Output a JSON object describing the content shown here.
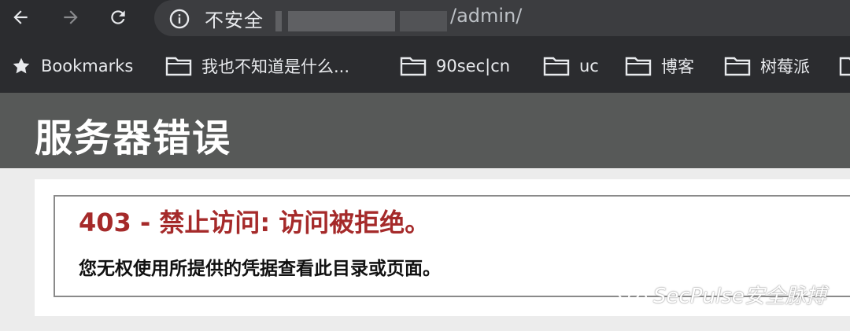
{
  "browser": {
    "address": {
      "security_label": "不安全",
      "path": "/admin/"
    },
    "bookmarks": [
      {
        "label": "Bookmarks",
        "icon": "star-icon"
      },
      {
        "label": "我也不知道是什么...",
        "icon": "folder-icon"
      },
      {
        "label": "90sec|cn",
        "icon": "folder-icon"
      },
      {
        "label": "uc",
        "icon": "folder-icon"
      },
      {
        "label": "博客",
        "icon": "folder-icon"
      },
      {
        "label": "树莓派",
        "icon": "folder-icon"
      }
    ]
  },
  "page": {
    "header_title": "服务器错误",
    "error_title": "403 - 禁止访问: 访问被拒绝。",
    "error_description": "您无权使用所提供的凭据查看此目录或页面。"
  },
  "watermark": {
    "text": "SecPulse安全脉搏"
  },
  "colors": {
    "browser_bg": "#2b2c2f",
    "header_bg": "#575958",
    "error_title": "#a52a2a"
  }
}
